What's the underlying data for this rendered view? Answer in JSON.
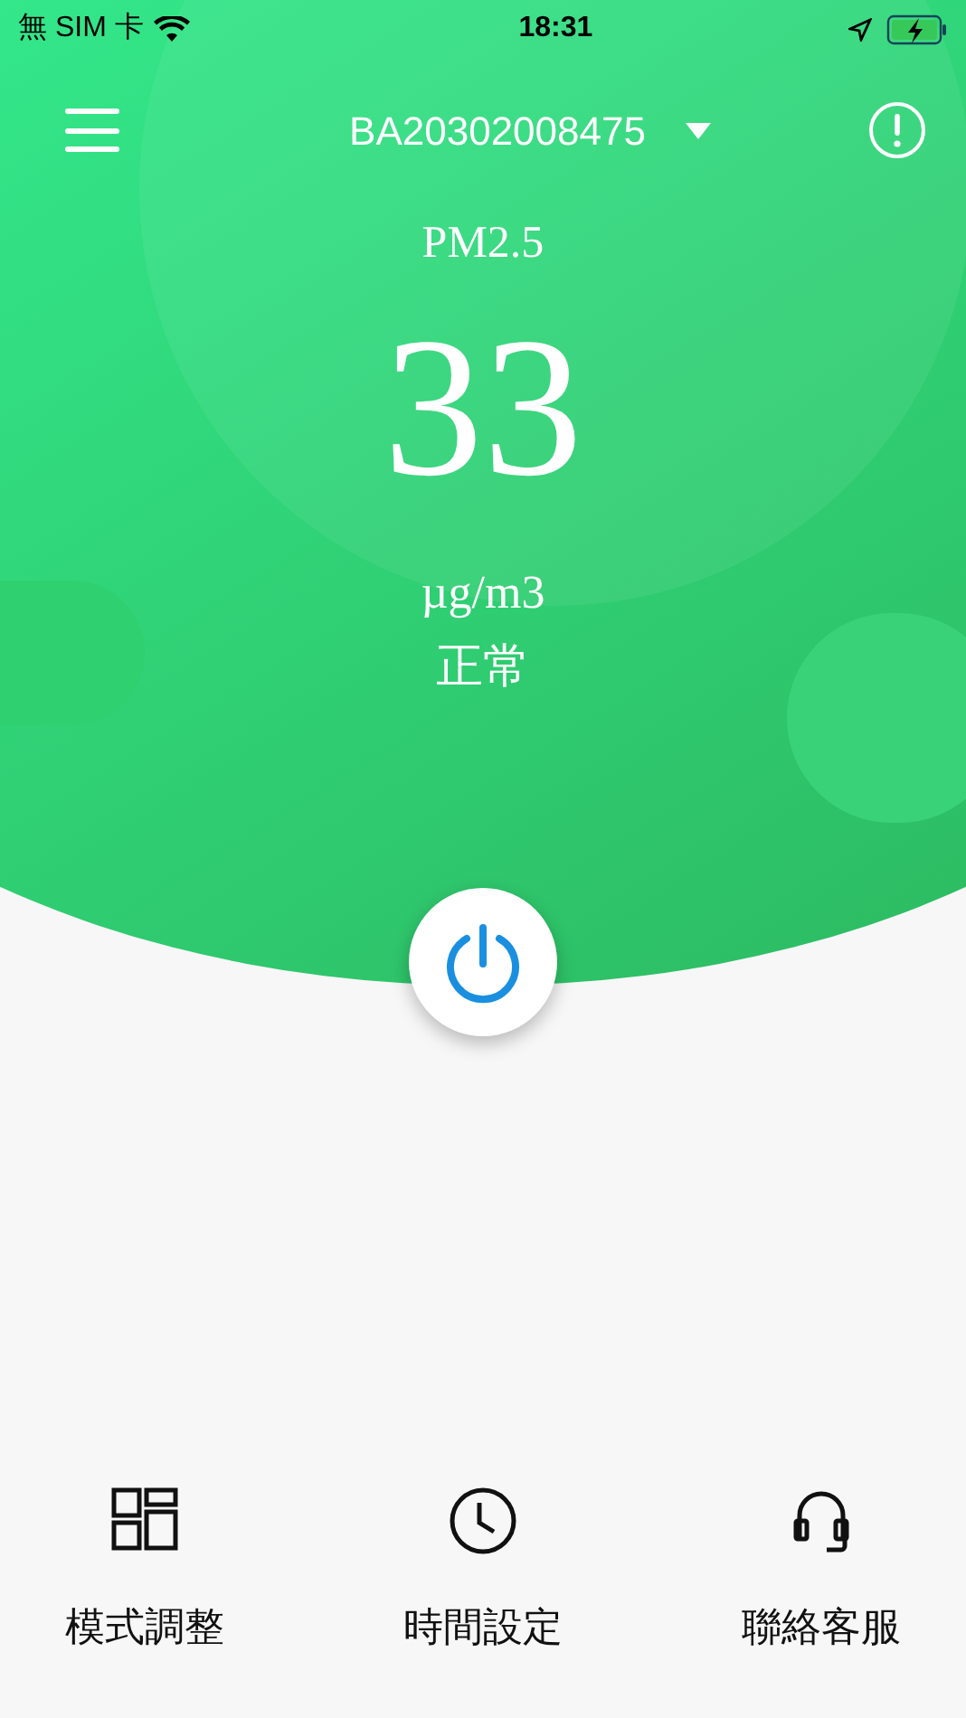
{
  "status_bar": {
    "carrier": "無 SIM 卡",
    "time": "18:31"
  },
  "header": {
    "device_id": "BA20302008475"
  },
  "reading": {
    "label": "PM2.5",
    "value": "33",
    "unit": "µg/m3",
    "status": "正常"
  },
  "nav": [
    {
      "kind": "grid",
      "label": "模式調整"
    },
    {
      "kind": "clock",
      "label": "時間設定"
    },
    {
      "kind": "headset",
      "label": "聯絡客服"
    }
  ]
}
